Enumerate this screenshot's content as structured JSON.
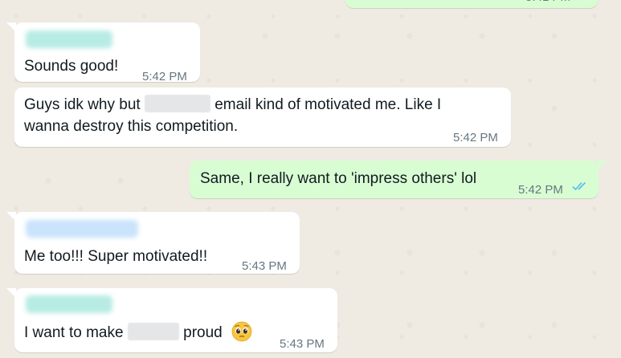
{
  "colors": {
    "background": "#efeae2",
    "incoming_bubble": "#ffffff",
    "outgoing_bubble": "#d9fdd3",
    "timestamp": "#667781",
    "read_ticks": "#53bdeb",
    "sender_name_blur_1": "#b7ece4",
    "sender_name_blur_2": "#c9e3fb"
  },
  "messages": [
    {
      "id": "m0",
      "direction": "outgoing",
      "partial": true,
      "ticks": "read-ticks-icon"
    },
    {
      "id": "m1",
      "direction": "incoming",
      "sender_redacted": true,
      "text": "Sounds good!",
      "time": "5:42 PM"
    },
    {
      "id": "m2",
      "direction": "incoming",
      "line1_a": "Guys idk why but",
      "line1_b": "email kind of motivated me. Like I",
      "line2": "wanna destroy this competition.",
      "time": "5:42 PM"
    },
    {
      "id": "m3",
      "direction": "outgoing",
      "text": "Same, I really want to 'impress others' lol",
      "time": "5:42 PM",
      "ticks": "read-ticks-icon"
    },
    {
      "id": "m4",
      "direction": "incoming",
      "sender_redacted": true,
      "text": "Me too!!! Super motivated!!",
      "time": "5:43 PM"
    },
    {
      "id": "m5",
      "direction": "incoming",
      "sender_redacted": true,
      "text_a": "I want to make",
      "text_b": "proud",
      "emoji": "pleading-face-emoji",
      "time": "5:43 PM"
    }
  ]
}
